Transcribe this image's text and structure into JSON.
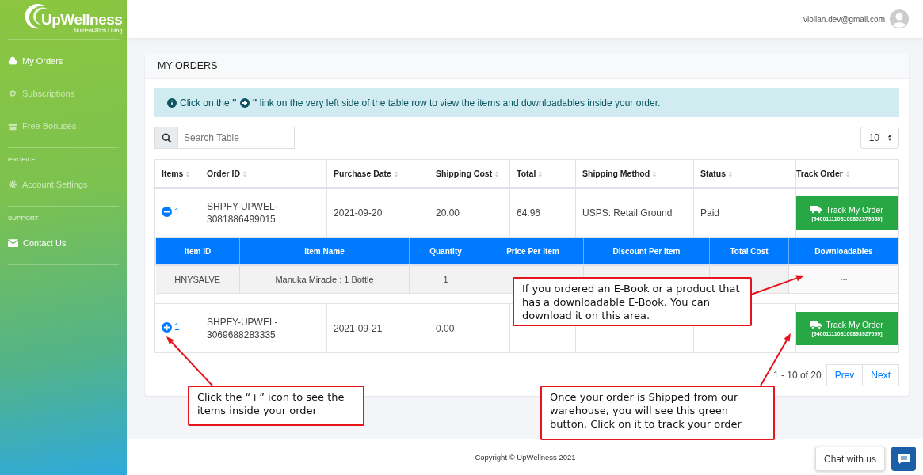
{
  "brand": {
    "name": "UpWellness",
    "tagline": "Nutrient-Rich Living"
  },
  "sidebar": {
    "sections": [
      {
        "items": [
          {
            "label": "My Orders",
            "disabled": false
          },
          {
            "label": "Subscriptions",
            "disabled": true
          },
          {
            "label": "Free Bonuses",
            "disabled": true
          }
        ]
      },
      {
        "heading": "PROFILE",
        "items": [
          {
            "label": "Account Settings",
            "disabled": true
          }
        ]
      },
      {
        "heading": "SUPPORT",
        "items": [
          {
            "label": "Contact Us",
            "disabled": false
          }
        ]
      }
    ]
  },
  "header": {
    "user_email": "viollan.dev@gmail.com"
  },
  "card": {
    "title": "MY ORDERS",
    "info": {
      "lead": "Click on the **\"**",
      "rest": "**\"** link on the very left side of the table row to view the items and downloadables inside your order."
    },
    "search": {
      "placeholder": "Search Table"
    },
    "page_size": "10",
    "table": {
      "columns": [
        "Items",
        "Order ID",
        "Purchase Date",
        "Shipping Cost",
        "Total",
        "Shipping Method",
        "Status",
        "Track Order"
      ],
      "rows": [
        {
          "items": "1",
          "expanded": true,
          "order_id": "SHPFY-UPWEL-3081886499015",
          "purchase_date": "2021-09-20",
          "shipping_cost": "20.00",
          "total": "64.96",
          "shipping_method": "USPS: Retail Ground",
          "status": "Paid",
          "track": {
            "label": "Track My Order",
            "tracking": "[9400111108100802379588]"
          },
          "details": {
            "columns": [
              "Item ID",
              "Item Name",
              "Quantity",
              "Price Per Item",
              "Discount Per Item",
              "Total Cost",
              "Downloadables"
            ],
            "rows": [
              {
                "item_id": "HNYSALVE",
                "item_name": "Manuka Miracle : 1 Bottle",
                "quantity": "1",
                "downloadables": "..."
              }
            ]
          }
        },
        {
          "items": "1",
          "expanded": false,
          "order_id": "SHPFY-UPWEL-3069688283335",
          "purchase_date": "2021-09-21",
          "shipping_cost": "0.00",
          "track": {
            "label": "Track My Order",
            "tracking": "[9400111108100893927699]"
          }
        }
      ]
    },
    "pagination": {
      "info": "1 - 10 of 20",
      "buttons": [
        "Prev",
        "Next"
      ]
    }
  },
  "footer": {
    "copyright": "Copyright © UpWellness 2021"
  },
  "chat": {
    "label": "Chat with us"
  },
  "annotations": [
    {
      "text": "If you ordered an E-Book or a product that has a downloadable E-Book. You can download it on this area."
    },
    {
      "text": "Click the “+” icon to see the items inside your order"
    },
    {
      "text": "Once your order is Shipped from our warehouse, you will see this green button. Click on it to track your order"
    }
  ]
}
